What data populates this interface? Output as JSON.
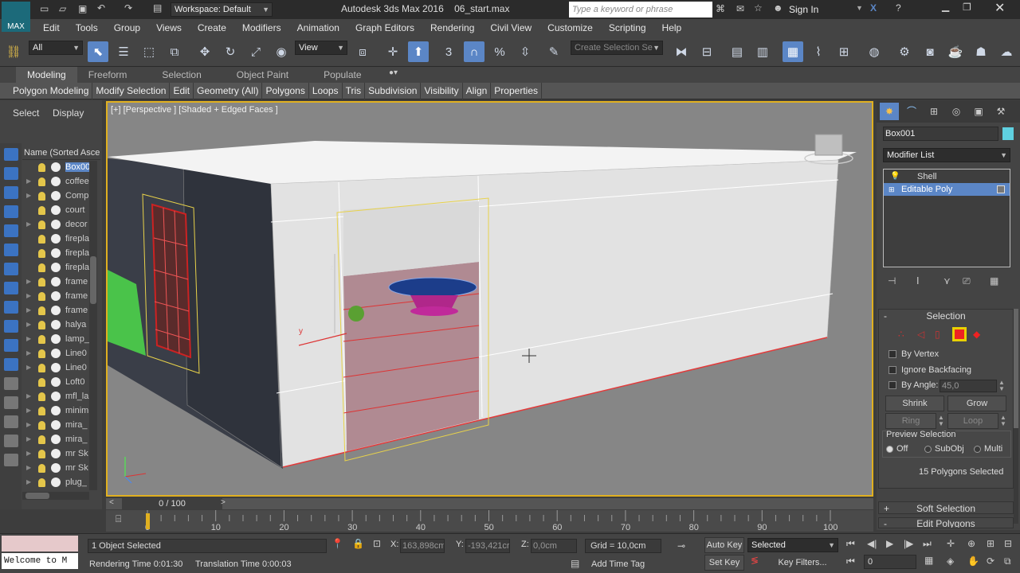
{
  "title": {
    "app_name": "Autodesk 3ds Max 2016",
    "file_name": "06_start.max",
    "workspace": "Workspace: Default",
    "search_placeholder": "Type a keyword or phrase",
    "sign_in": "Sign In"
  },
  "menu": [
    "Edit",
    "Tools",
    "Group",
    "Views",
    "Create",
    "Modifiers",
    "Animation",
    "Graph Editors",
    "Rendering",
    "Civil View",
    "Customize",
    "Scripting",
    "Help"
  ],
  "toolbar": {
    "filter_value": "All",
    "ref_coord": "View",
    "snap_label": "3",
    "selection_set_placeholder": "Create Selection Se"
  },
  "ribbon": {
    "tabs": [
      "Modeling",
      "Freeform",
      "Selection",
      "Object Paint",
      "Populate"
    ],
    "items": [
      "Polygon Modeling",
      "Modify Selection",
      "Edit",
      "Geometry (All)",
      "Polygons",
      "Loops",
      "Tris",
      "Subdivision",
      "Visibility",
      "Align",
      "Properties"
    ]
  },
  "scene_explorer": {
    "tabs": [
      "Select",
      "Display"
    ],
    "column_header": "Name (Sorted Ascer",
    "rows": [
      "Box00",
      "coffee",
      "Comp",
      "court",
      "decor",
      "firepla",
      "firepla",
      "firepla",
      "frame",
      "frame",
      "frame",
      "halya",
      "lamp_",
      "Line0",
      "Line0",
      "Loft0",
      "mfl_la",
      "minim",
      "mira_",
      "mira_",
      "mr Sk",
      "mr Sk",
      "plug_"
    ]
  },
  "viewport": {
    "label": "[+] [Perspective ] [Shaded + Edged Faces ]"
  },
  "command_panel": {
    "object_name": "Box001",
    "object_color": "#5fd0e0",
    "modifier_list": "Modifier List",
    "stack": [
      "Shell",
      "Editable Poly"
    ],
    "selection_header": "Selection",
    "by_vertex": "By Vertex",
    "ignore_backfacing": "Ignore Backfacing",
    "by_angle": "By Angle:",
    "angle_value": "45,0",
    "shrink": "Shrink",
    "grow": "Grow",
    "ring": "Ring",
    "loop": "Loop",
    "preview_selection": "Preview Selection",
    "preview_options": [
      "Off",
      "SubObj",
      "Multi"
    ],
    "selected_info": "15 Polygons Selected",
    "soft_selection": "Soft Selection",
    "edit_polygons": "Edit Polygons"
  },
  "timeline": {
    "frame_counter": "0 / 100",
    "ticks": [
      "0",
      "10",
      "20",
      "30",
      "40",
      "50",
      "60",
      "70",
      "80",
      "90",
      "100"
    ],
    "current_frame": 0,
    "max_frame": 100
  },
  "status": {
    "maxscript": "Welcome to M",
    "objects_selected": "1 Object Selected",
    "rendering_time": "Rendering Time  0:01:30",
    "translation_time": "Translation Time  0:00:03",
    "x_label": "X:",
    "x_value": "163,898cm",
    "y_label": "Y:",
    "y_value": "-193,421cr",
    "z_label": "Z:",
    "z_value": "0,0cm",
    "grid": "Grid = 10,0cm",
    "add_time_tag": "Add Time Tag",
    "auto_key": "Auto Key",
    "set_key": "Set Key",
    "key_mode": "Selected",
    "key_filters": "Key Filters...",
    "frame_value": "0"
  }
}
